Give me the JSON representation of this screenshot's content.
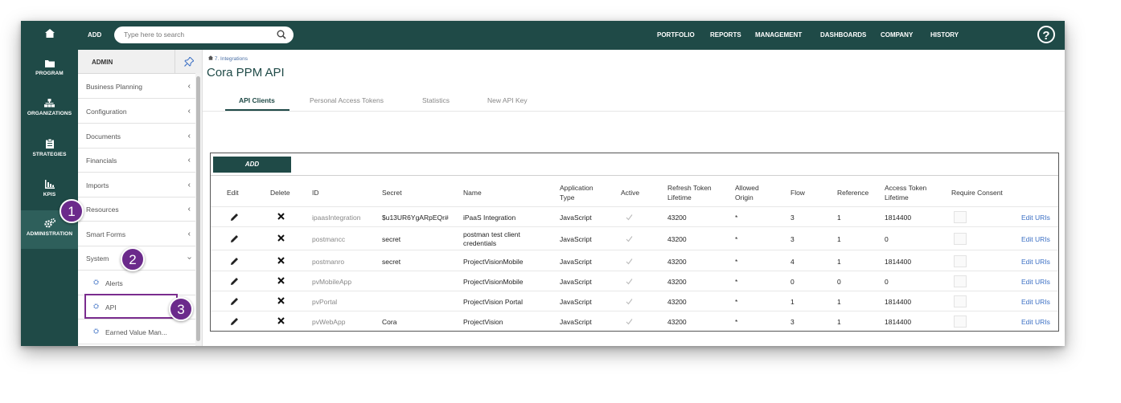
{
  "rail": {
    "items": [
      {
        "label": ""
      },
      {
        "label": "PROGRAM"
      },
      {
        "label": "ORGANIZATIONS"
      },
      {
        "label": "STRATEGIES"
      },
      {
        "label": "KPIS"
      },
      {
        "label": "ADMINISTRATION"
      }
    ]
  },
  "topbar": {
    "add_label": "ADD",
    "search_placeholder": "Type here to search",
    "nav": [
      "PORTFOLIO",
      "REPORTS",
      "MANAGEMENT",
      "DASHBOARDS",
      "COMPANY",
      "HISTORY"
    ],
    "help": "?"
  },
  "admin": {
    "title": "ADMIN",
    "menu": [
      "Business Planning",
      "Configuration",
      "Documents",
      "Financials",
      "Imports",
      "Resources",
      "Smart Forms",
      "System"
    ],
    "submenu": [
      "Alerts",
      "API",
      "Earned Value Man..."
    ]
  },
  "callouts": [
    "1",
    "2",
    "3"
  ],
  "breadcrumb": "7. Integrations",
  "page_title": "Cora PPM API",
  "tabs": [
    "API Clients",
    "Personal Access Tokens",
    "Statistics",
    "New API Key"
  ],
  "table": {
    "add_label": "ADD",
    "headers": [
      "Edit",
      "Delete",
      "ID",
      "Secret",
      "Name",
      "Application Type",
      "Active",
      "Refresh Token Lifetime",
      "Allowed Origin",
      "Flow",
      "Reference",
      "Access Token Lifetime",
      "Require Consent"
    ],
    "rows": [
      {
        "id": "ipaasIntegration",
        "secret": "$u13UR6YgARpEQr#",
        "name": "iPaaS Integration",
        "app_type": "JavaScript",
        "active": true,
        "refresh": "43200",
        "origin": "*",
        "flow": "3",
        "reference": "1",
        "access": "1814400",
        "require_consent": false,
        "action": "Edit URIs"
      },
      {
        "id": "postmancc",
        "secret": "secret",
        "name": "postman test client credentials",
        "app_type": "JavaScript",
        "active": true,
        "refresh": "43200",
        "origin": "*",
        "flow": "3",
        "reference": "1",
        "access": "0",
        "require_consent": false,
        "action": "Edit URIs"
      },
      {
        "id": "postmanro",
        "secret": "secret",
        "name": "ProjectVisionMobile",
        "app_type": "JavaScript",
        "active": true,
        "refresh": "43200",
        "origin": "*",
        "flow": "4",
        "reference": "1",
        "access": "1814400",
        "require_consent": false,
        "action": "Edit URIs"
      },
      {
        "id": "pvMobileApp",
        "secret": "",
        "name": "ProjectVisionMobile",
        "app_type": "JavaScript",
        "active": true,
        "refresh": "43200",
        "origin": "*",
        "flow": "0",
        "reference": "0",
        "access": "0",
        "require_consent": false,
        "action": "Edit URIs"
      },
      {
        "id": "pvPortal",
        "secret": "",
        "name": "ProjectVision Portal",
        "app_type": "JavaScript",
        "active": true,
        "refresh": "43200",
        "origin": "*",
        "flow": "1",
        "reference": "1",
        "access": "1814400",
        "require_consent": false,
        "action": "Edit URIs"
      },
      {
        "id": "pvWebApp",
        "secret": "Cora",
        "name": "ProjectVision",
        "app_type": "JavaScript",
        "active": true,
        "refresh": "43200",
        "origin": "*",
        "flow": "3",
        "reference": "1",
        "access": "1814400",
        "require_consent": false,
        "action": "Edit URIs"
      }
    ]
  },
  "colors": {
    "brand": "#1f4a47",
    "callout": "#6b2a8b",
    "link": "#3b6fc4"
  }
}
